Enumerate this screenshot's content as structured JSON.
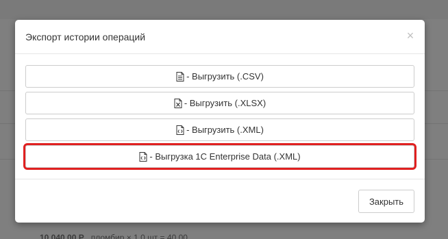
{
  "background": {
    "bottom_amount": "10 040,00 Р",
    "bottom_text": "пломбир × 1,0 шт = 40,00"
  },
  "modal": {
    "title": "Экспорт истории операций",
    "close_glyph": "×",
    "buttons": [
      {
        "label": "- Выгрузить (.CSV)",
        "icon": "file-text-icon"
      },
      {
        "label": "- Выгрузить (.XLSX)",
        "icon": "file-excel-icon"
      },
      {
        "label": "- Выгрузить (.XML)",
        "icon": "file-code-icon"
      },
      {
        "label": "- Выгрузка 1С Enterprise Data (.XML)",
        "icon": "file-code-icon",
        "highlighted": true
      }
    ],
    "footer_close_label": "Закрыть"
  },
  "colors": {
    "highlight": "#e02020",
    "overlay": "#7f7f7f"
  }
}
